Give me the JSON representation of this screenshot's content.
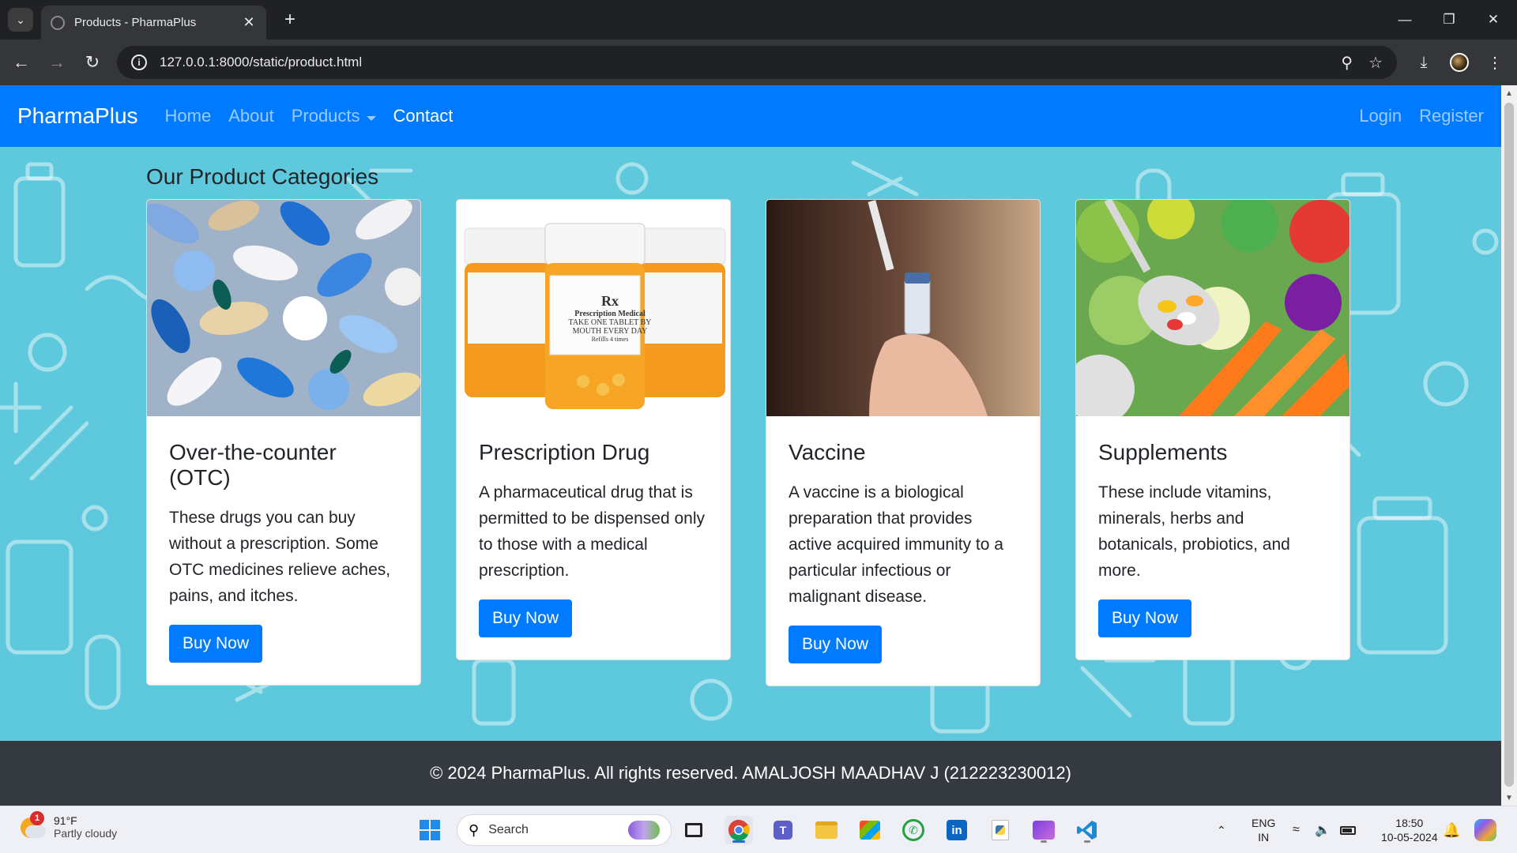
{
  "browser": {
    "tab_title": "Products - PharmaPlus",
    "url": "127.0.0.1:8000/static/product.html"
  },
  "navbar": {
    "brand": "PharmaPlus",
    "links": [
      "Home",
      "About",
      "Products",
      "Contact"
    ],
    "right_links": [
      "Login",
      "Register"
    ]
  },
  "page": {
    "section_title": "Our Product Categories",
    "cards": [
      {
        "title": "Over-the-counter (OTC)",
        "text": "These drugs you can buy without a prescription. Some OTC medicines relieve aches, pains, and itches.",
        "button": "Buy Now"
      },
      {
        "title": "Prescription Drug",
        "text": "A pharmaceutical drug that is permitted to be dispensed only to those with a medical prescription.",
        "button": "Buy Now"
      },
      {
        "title": "Vaccine",
        "text": "A vaccine is a biological preparation that provides active acquired immunity to a particular infectious or malignant disease.",
        "button": "Buy Now"
      },
      {
        "title": "Supplements",
        "text": "These include vitamins, minerals, herbs and botanicals, probiotics, and more.",
        "button": "Buy Now"
      }
    ],
    "bottle_label": {
      "rx": "Rx",
      "line1": "Prescription Medical",
      "line2": "TAKE ONE TABLET BY",
      "line3": "MOUTH EVERY DAY",
      "line4": "Refills 4 times"
    },
    "footer": "© 2024 PharmaPlus. All rights reserved. AMALJOSH MAADHAV J (212223230012)"
  },
  "taskbar": {
    "weather_temp": "91°F",
    "weather_desc": "Partly cloudy",
    "weather_badge": "1",
    "search_label": "Search",
    "lang_top": "ENG",
    "lang_bottom": "IN",
    "time": "18:50",
    "date": "10-05-2024"
  },
  "colors": {
    "primary": "#007bff",
    "background_pattern": "#5ec9dc",
    "footer": "#343a40"
  }
}
